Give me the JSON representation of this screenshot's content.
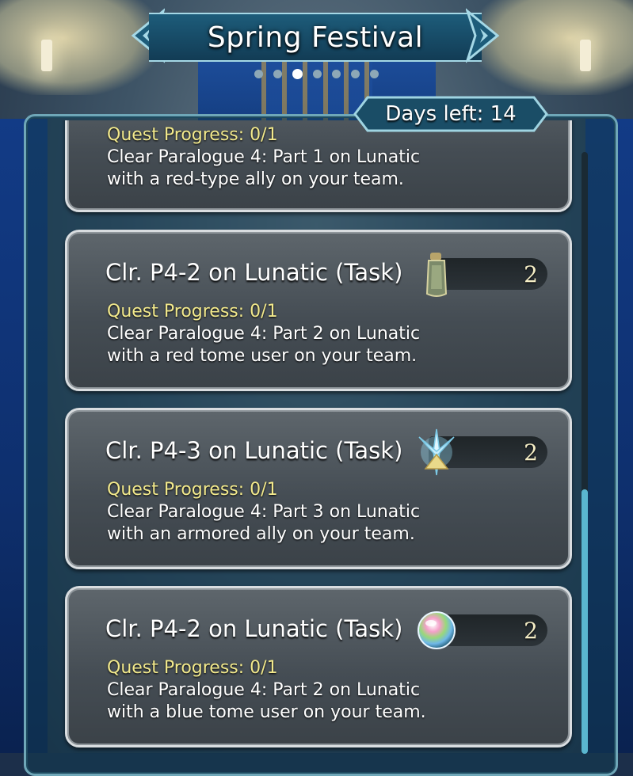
{
  "header": {
    "title": "Spring Festival",
    "page_count": 7,
    "active_page": 3
  },
  "days_left": "Days left: 14",
  "quests": [
    {
      "title": "",
      "progress": "Quest Progress: 0/1",
      "desc_line1": "Clear Paralogue 4: Part 1 on Lunatic",
      "desc_line2": "with a red-type ally on your team.",
      "reward_icon": "",
      "reward_count": ""
    },
    {
      "title": "Clr. P4-2 on Lunatic (Task)",
      "progress": "Quest Progress: 0/1",
      "desc_line1": "Clear Paralogue 4: Part 2 on Lunatic",
      "desc_line2": "with a red tome user on your team.",
      "reward_icon": "sacred-coin-bottle-icon",
      "reward_count": "2"
    },
    {
      "title": "Clr. P4-3 on Lunatic (Task)",
      "progress": "Quest Progress: 0/1",
      "desc_line1": "Clear Paralogue 4: Part 3 on Lunatic",
      "desc_line2": "with an armored ally on your team.",
      "reward_icon": "hero-feather-crest-icon",
      "reward_count": "2"
    },
    {
      "title": "Clr. P4-2 on Lunatic (Task)",
      "progress": "Quest Progress: 0/1",
      "desc_line1": "Clear Paralogue 4: Part 2 on Lunatic",
      "desc_line2": "with a blue tome user on your team.",
      "reward_icon": "orb-icon",
      "reward_count": "2"
    }
  ],
  "colors": {
    "progress_text": "#f2e98c",
    "frame_border": "#6fa7b8",
    "scroll_thumb": "#5ab6cf"
  }
}
